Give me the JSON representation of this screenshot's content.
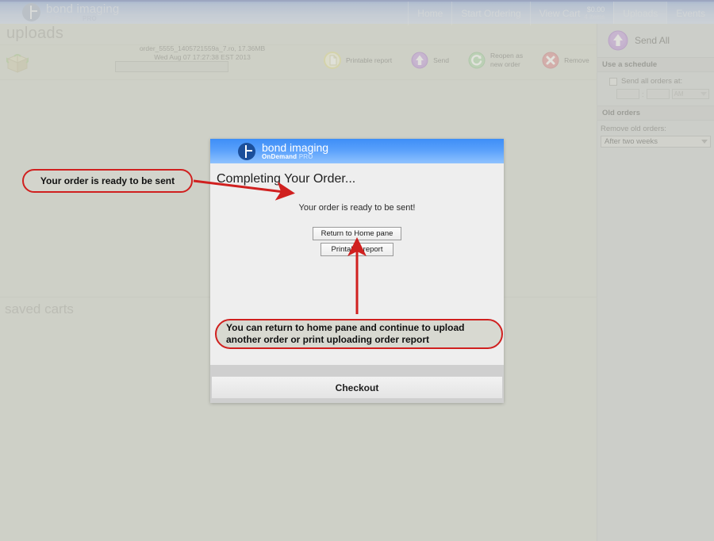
{
  "topbar": {
    "brand_name": "bond imaging",
    "brand_sub": "OnDemand",
    "brand_sub_pro": "PRO",
    "nav": [
      {
        "label": "Home",
        "active": false
      },
      {
        "label": "Start Ordering",
        "active": false
      },
      {
        "label": "Uploads",
        "active": true
      },
      {
        "label": "Events",
        "active": false
      }
    ],
    "cart": {
      "label": "View Cart",
      "amount": "$0.00",
      "items": "4 items"
    }
  },
  "page": {
    "title": "uploads",
    "saved_carts_title": "saved carts"
  },
  "upload_row": {
    "order_name": "order_5555_1405721559a_7.ro, 17.36MB",
    "order_date": "Wed Aug 07 17:27:38 EST 2013",
    "package_icon": "package-icon",
    "progress_value": "",
    "actions": [
      {
        "label": "Printable report",
        "icon": "document-icon",
        "color": "#e3e07a"
      },
      {
        "label": "Send",
        "icon": "upload-arrow-icon",
        "color": "#b07fd4"
      },
      {
        "label": "Reopen as\nnew order",
        "icon": "refresh-icon",
        "color": "#8fc68c"
      },
      {
        "label": "Remove",
        "icon": "close-x-icon",
        "color": "#d4767c"
      }
    ]
  },
  "sidebar": {
    "send_all_label": "Send All",
    "send_all_icon": "upload-arrow-icon",
    "schedule_heading": "Use a schedule",
    "schedule_checkbox_label": "Send all orders at:",
    "schedule_checked": false,
    "time_hour": "",
    "time_minute": "",
    "time_separator": ":",
    "ampm_value": "AM",
    "old_orders_heading": "Old orders",
    "remove_old_label": "Remove old orders:",
    "remove_old_value": "After two weeks"
  },
  "modal": {
    "brand_name": "bond imaging",
    "brand_sub": "OnDemand",
    "brand_sub_pro": "PRO",
    "title": "Completing Your Order...",
    "message": "Your order is ready to be sent!",
    "buttons": [
      {
        "label": "Return to Home pane"
      },
      {
        "label": "Printable report"
      }
    ],
    "footer_label": "Checkout"
  },
  "annotations": [
    {
      "text": "Your order is ready to be sent",
      "color": "#d0201f"
    },
    {
      "text": "You can return to home pane and continue to upload another order or print uploading order report",
      "color": "#d0201f"
    }
  ]
}
